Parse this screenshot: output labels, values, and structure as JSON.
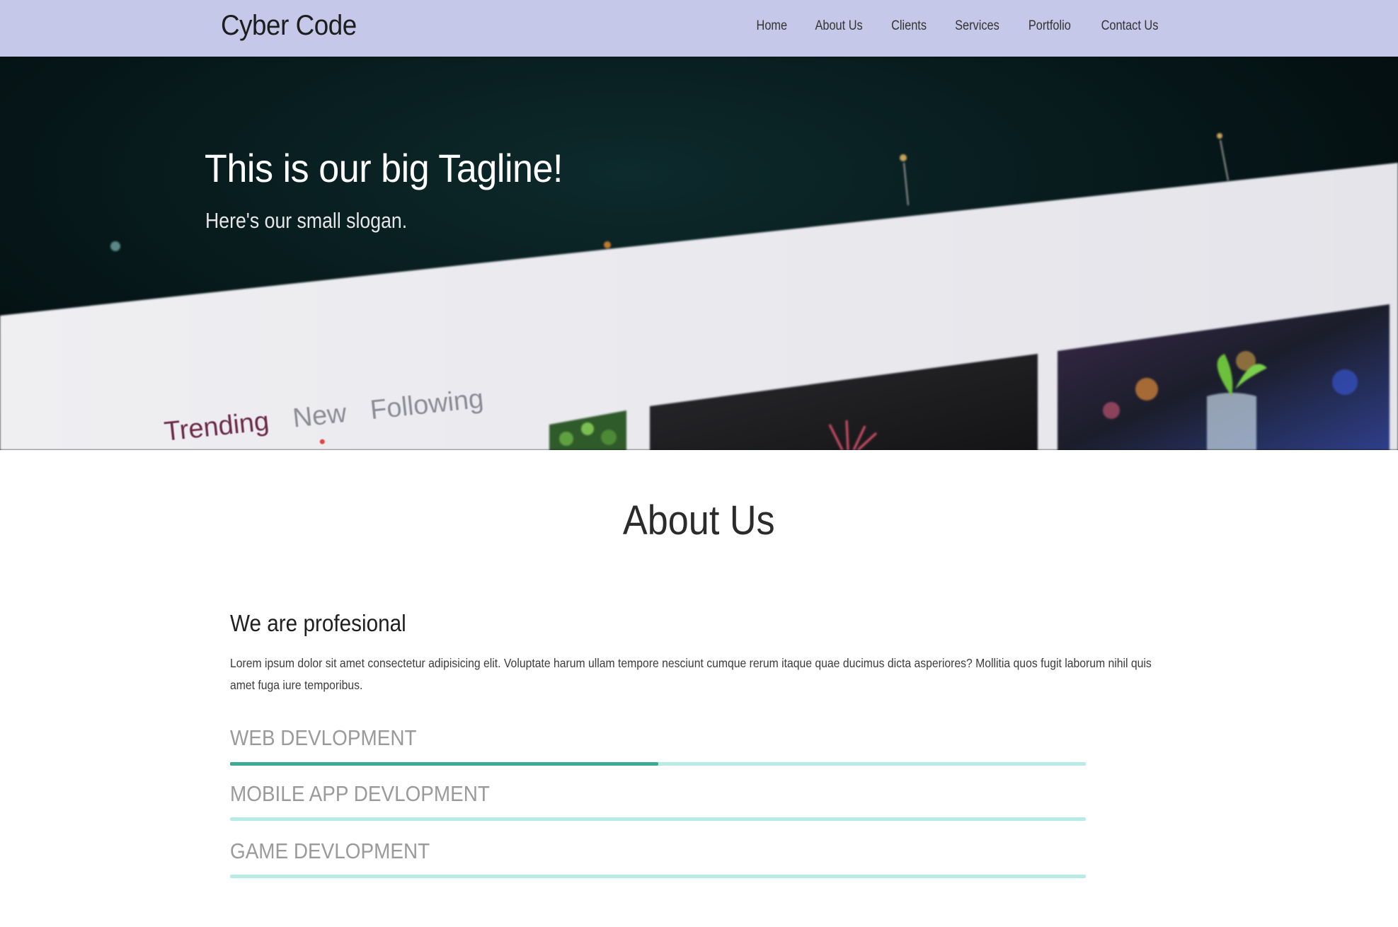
{
  "navbar": {
    "brand": "Cyber Code",
    "links": [
      "Home",
      "About Us",
      "Clients",
      "Services",
      "Portfolio",
      "Contact Us"
    ]
  },
  "hero": {
    "tagline": "This is our big Tagline!",
    "slogan": "Here's our small slogan.",
    "screen_tabs": [
      "Trending",
      "New",
      "Following"
    ],
    "active_tab": "New"
  },
  "about": {
    "title": "About Us",
    "subtitle": "We are profesional",
    "text": "Lorem ipsum dolor sit amet consectetur adipisicing elit. Voluptate harum ullam tempore nesciunt cumque rerum itaque quae ducimus dicta asperiores? Mollitia quos fugit laborum nihil quis amet fuga iure temporibus.",
    "skills": [
      {
        "label": "WEB DEVLOPMENT",
        "progress": 0.5
      },
      {
        "label": "MOBILE APP DEVLOPMENT",
        "progress": 0
      },
      {
        "label": "GAME DEVLOPMENT",
        "progress": 0
      }
    ]
  },
  "colors": {
    "navbar_bg": "#c5c8e8",
    "skill_track": "#b7ece6",
    "skill_fill": "#3aaa97"
  }
}
